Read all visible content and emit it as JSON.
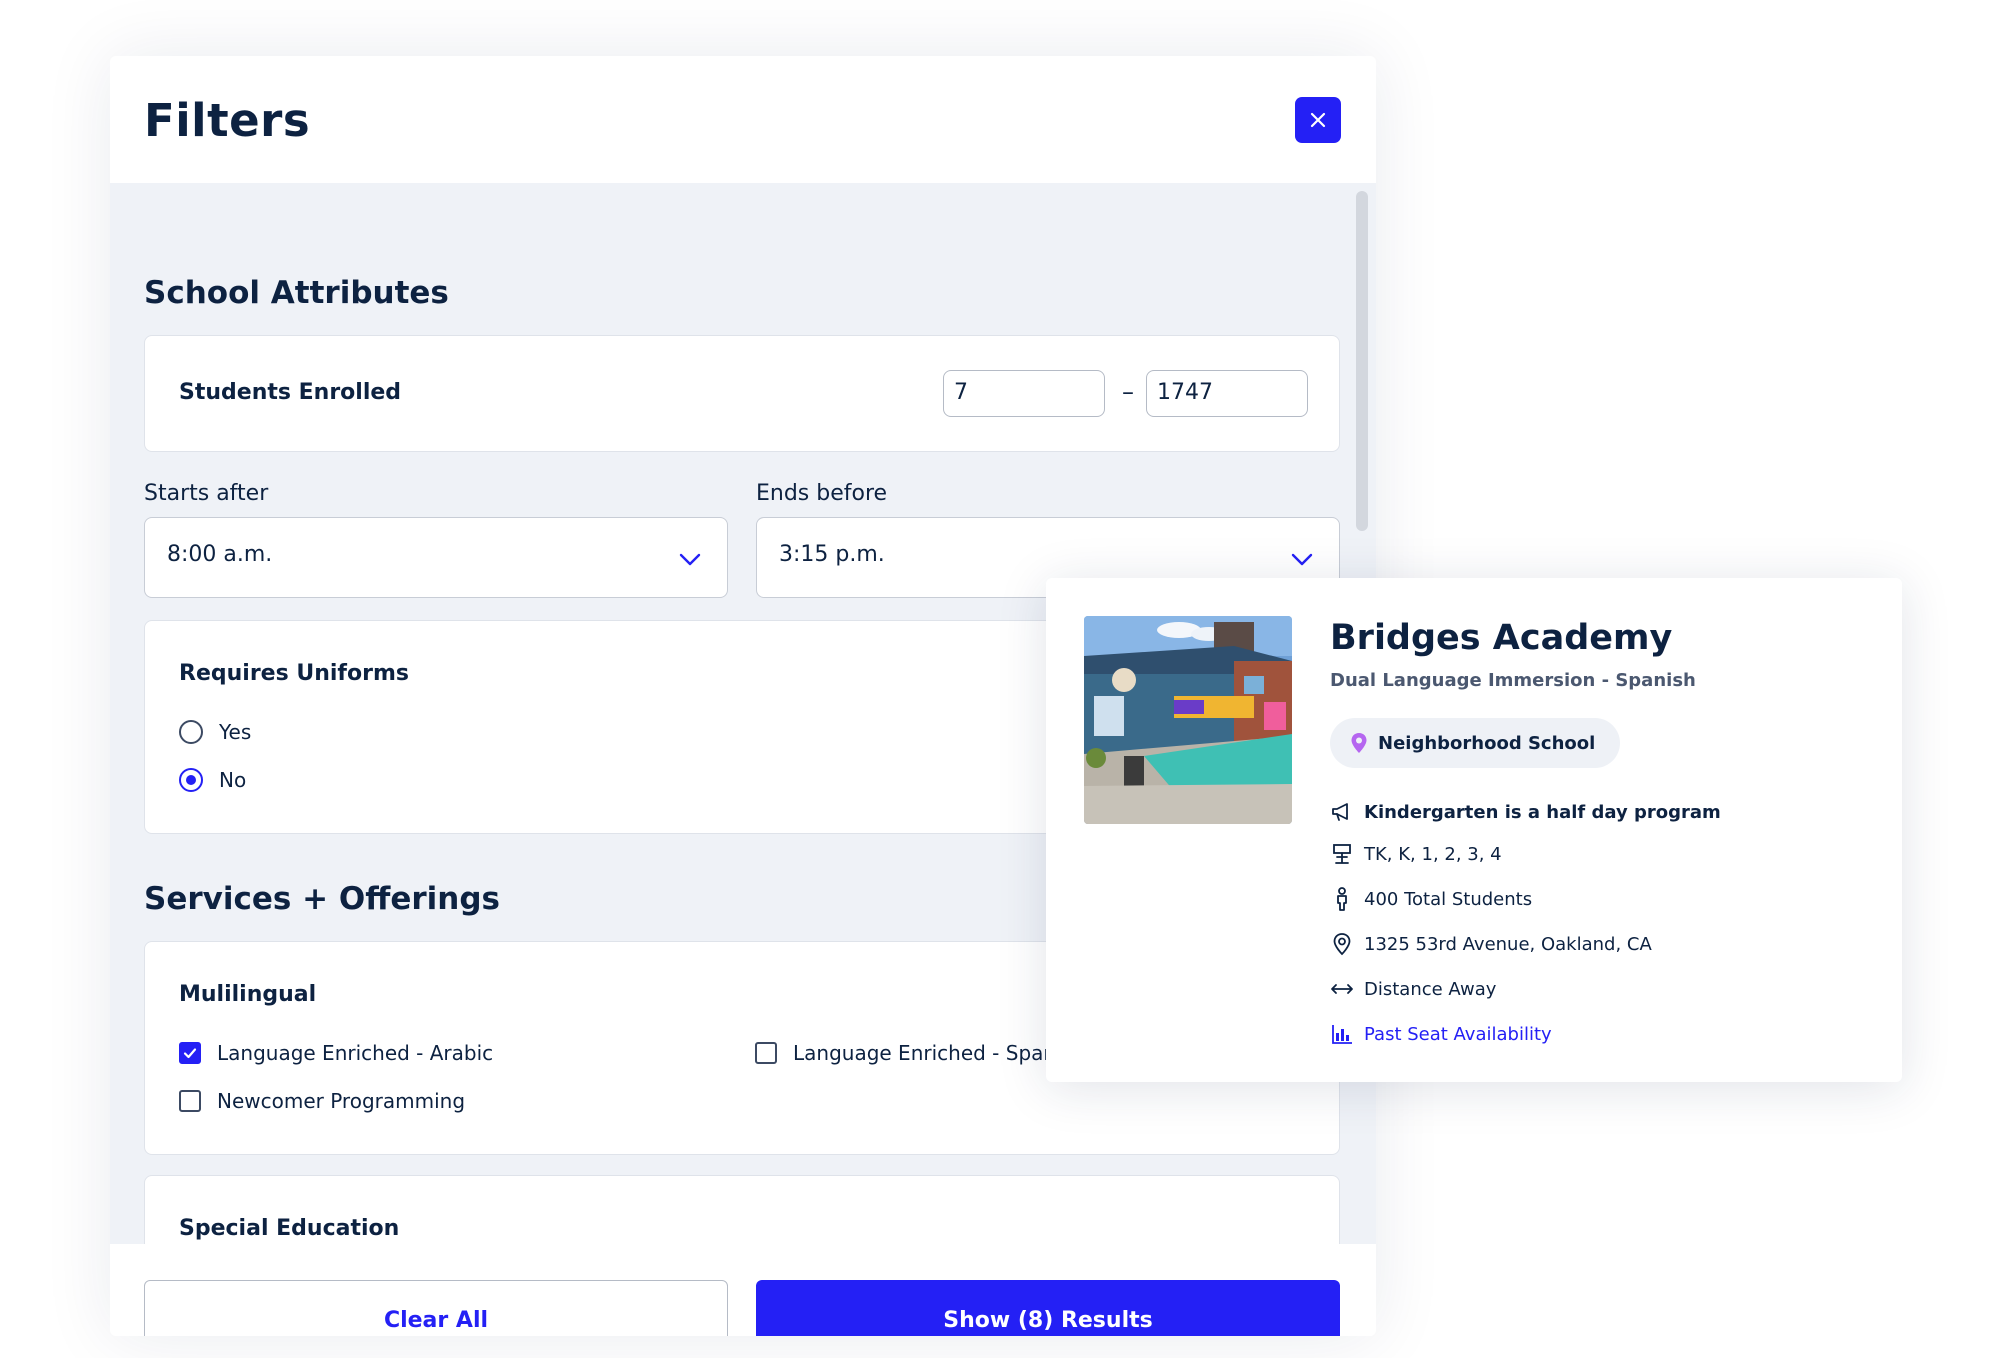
{
  "filters": {
    "title": "Filters",
    "school_attributes": {
      "title": "School Attributes",
      "students_enrolled": {
        "label": "Students Enrolled",
        "min": "7",
        "max": "1747",
        "separator": "–"
      },
      "starts_after": {
        "label": "Starts after",
        "value": "8:00 a.m."
      },
      "ends_before": {
        "label": "Ends before",
        "value": "3:15 p.m."
      },
      "uniforms": {
        "label": "Requires Uniforms",
        "options": [
          {
            "label": "Yes",
            "selected": false
          },
          {
            "label": "No",
            "selected": true
          }
        ]
      }
    },
    "services": {
      "title": "Services + Offerings",
      "multilingual": {
        "label": "Mulilingual",
        "options": [
          {
            "label": "Language Enriched - Arabic",
            "checked": true
          },
          {
            "label": "Language Enriched - Spanish",
            "checked": false
          },
          {
            "label": "Newcomer Programming",
            "checked": false
          }
        ]
      },
      "special_education": {
        "label": "Special Education"
      }
    },
    "footer": {
      "clear_label": "Clear All",
      "show_label": "Show (8) Results"
    }
  },
  "school": {
    "name": "Bridges Academy",
    "program": "Dual Language Immersion - Spanish",
    "badge": "Neighborhood School",
    "kindergarten": "Kindergarten is a half day program",
    "grades": "TK, K, 1, 2, 3, 4",
    "students": "400 Total Students",
    "address": "1325 53rd Avenue, Oakland, CA",
    "distance": "Distance Away",
    "seat_link": "Past Seat Availability"
  },
  "colors": {
    "accent": "#2420f5",
    "text": "#0d2241",
    "body_bg": "#eff2f7",
    "pin": "#b566f0"
  }
}
